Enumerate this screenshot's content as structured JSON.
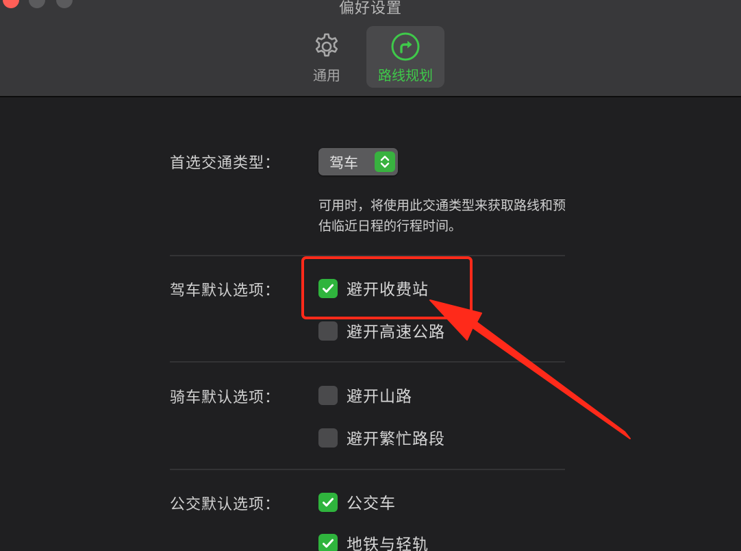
{
  "window": {
    "title": "偏好设置"
  },
  "toolbar": {
    "tabs": [
      {
        "label": "通用",
        "icon": "gear-icon",
        "selected": false
      },
      {
        "label": "路线规划",
        "icon": "route-arrow-icon",
        "selected": true
      }
    ]
  },
  "transport": {
    "label": "首选交通类型：",
    "value": "驾车",
    "description": "可用时，将使用此交通类型来获取路线和预估临近日程的行程时间。"
  },
  "driving": {
    "label": "驾车默认选项：",
    "options": [
      {
        "label": "避开收费站",
        "checked": true
      },
      {
        "label": "避开高速公路",
        "checked": false
      }
    ]
  },
  "cycling": {
    "label": "骑车默认选项：",
    "options": [
      {
        "label": "避开山路",
        "checked": false
      },
      {
        "label": "避开繁忙路段",
        "checked": false
      }
    ]
  },
  "transit": {
    "label": "公交默认选项：",
    "options": [
      {
        "label": "公交车",
        "checked": true
      },
      {
        "label": "地铁与轻轨",
        "checked": true
      }
    ]
  },
  "colors": {
    "accent_green": "#3fc94a",
    "annotation_red": "#ff2a1a",
    "background": "#1f1f21",
    "toolbar": "#38383a"
  }
}
